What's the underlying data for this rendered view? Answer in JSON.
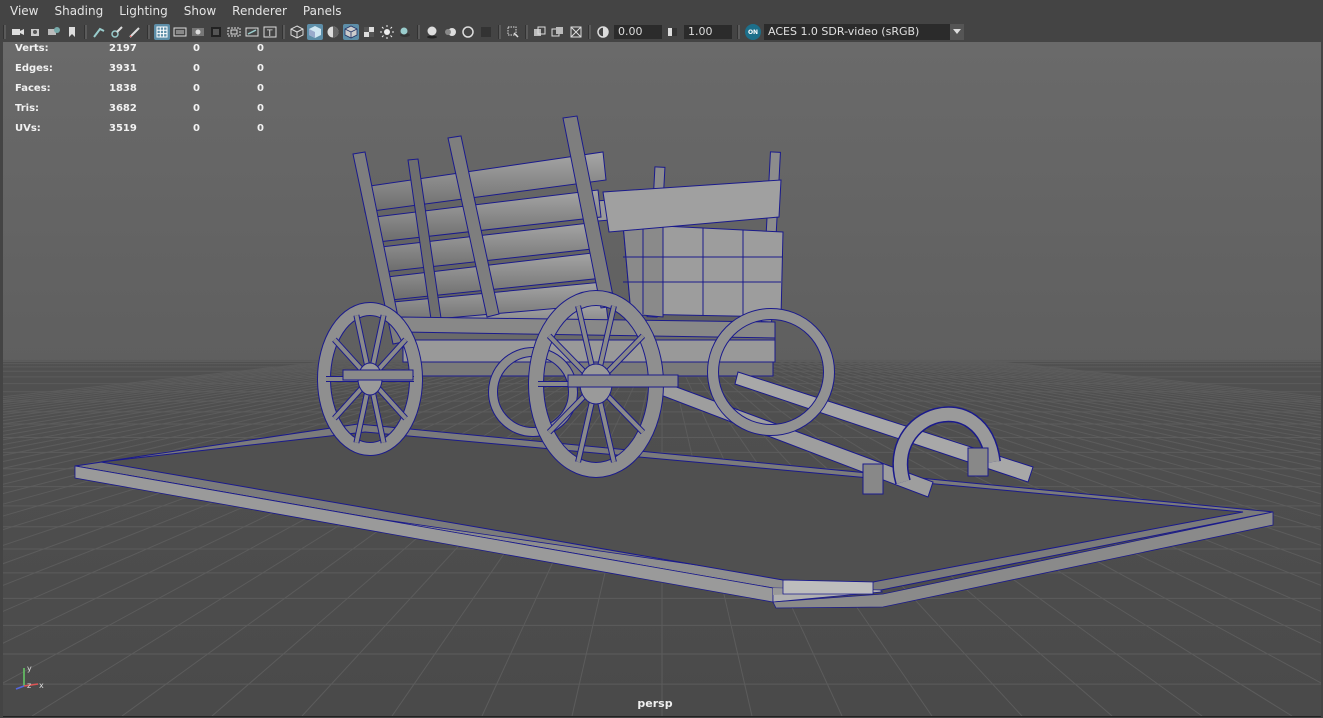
{
  "menubar": {
    "items": [
      "View",
      "Shading",
      "Lighting",
      "Show",
      "Renderer",
      "Panels"
    ]
  },
  "toolbar": {
    "exposure_value": "0.00",
    "gamma_value": "1.00",
    "color_management_toggle": "ON",
    "color_space": "ACES 1.0 SDR-video (sRGB)",
    "icons": [
      "select-camera-icon",
      "camera-attributes-icon",
      "bookmarks-icon",
      "image-plane-icon",
      "two-d-pan-zoom-icon",
      "grease-pencil-icon",
      "grid-icon",
      "film-gate-icon",
      "resolution-gate-icon",
      "gate-mask-icon",
      "field-chart-icon",
      "safe-action-icon",
      "safe-title-icon",
      "wireframe-icon",
      "smooth-shade-icon",
      "default-material-icon",
      "wireframe-on-shaded-icon",
      "textured-icon",
      "use-all-lights-icon",
      "shadows-icon",
      "screen-space-ao-icon",
      "motion-blur-icon",
      "multisample-aa-icon",
      "depth-of-field-icon",
      "isolate-select-icon",
      "xray-icon",
      "xray-joints-icon",
      "xray-components-icon",
      "exposure-icon",
      "gamma-icon",
      "color-management-icon"
    ]
  },
  "hud": {
    "rows": [
      {
        "label": "Verts:",
        "v1": "2197",
        "v2": "0",
        "v3": "0"
      },
      {
        "label": "Edges:",
        "v1": "3931",
        "v2": "0",
        "v3": "0"
      },
      {
        "label": "Faces:",
        "v1": "1838",
        "v2": "0",
        "v3": "0"
      },
      {
        "label": "Tris:",
        "v1": "3682",
        "v2": "0",
        "v3": "0"
      },
      {
        "label": "UVs:",
        "v1": "3519",
        "v2": "0",
        "v3": "0"
      }
    ]
  },
  "viewport": {
    "camera_name": "persp",
    "axis_labels": {
      "x": "x",
      "y": "y",
      "z": "z"
    },
    "colors": {
      "background_top": "#686868",
      "grid": "#555555",
      "wireframe": "#1a1a8c",
      "model": "#8a8a8a"
    }
  }
}
